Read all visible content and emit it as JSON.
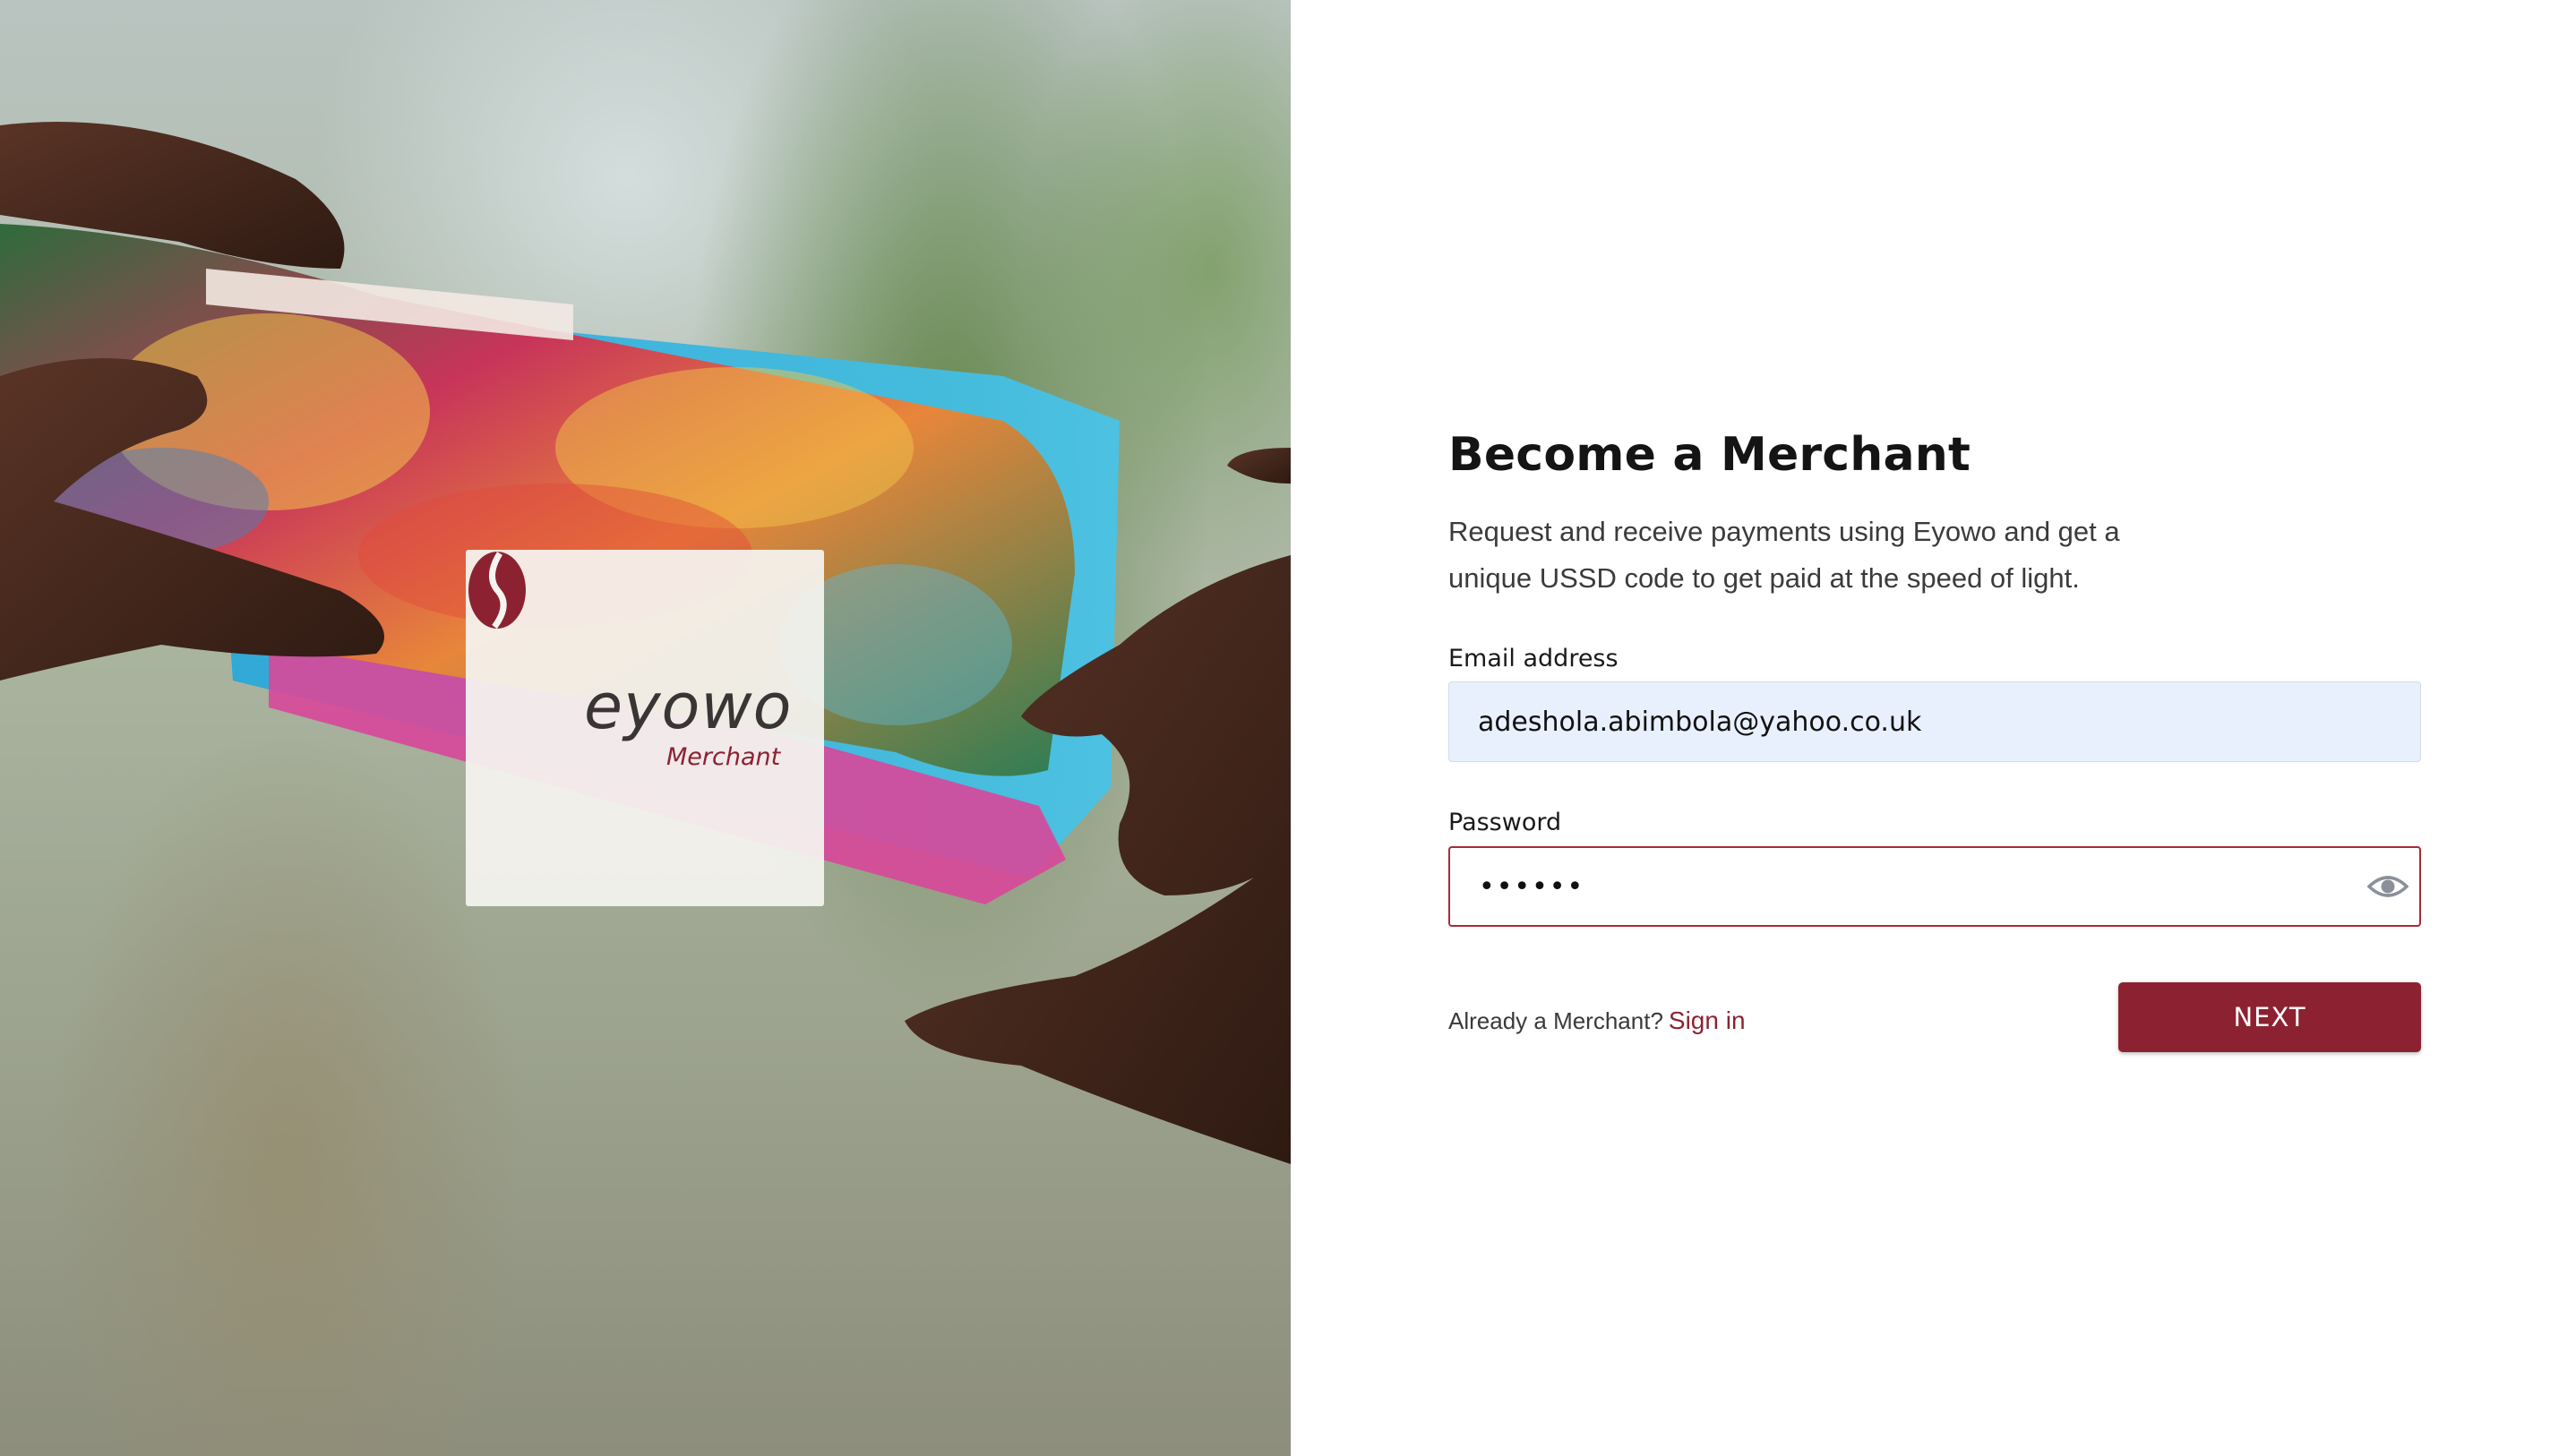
{
  "hero": {
    "logo": {
      "wordmark": "eyowo",
      "subtitle": "Merchant",
      "icon": "eyowo-logo-icon"
    }
  },
  "form": {
    "title": "Become a Merchant",
    "description": "Request and receive payments using Eyowo and get a unique USSD code to get paid at the speed of light.",
    "email": {
      "label": "Email address",
      "value": "adeshola.abimbola@yahoo.co.uk"
    },
    "password": {
      "label": "Password",
      "value": "••••••",
      "toggle_icon": "eye-icon"
    },
    "already_text": "Already a Merchant?",
    "signin_label": "Sign in",
    "next_label": "NEXT"
  },
  "colors": {
    "brand": "#8c2231",
    "email_fill": "#e8f0fe",
    "password_border": "#a72a3a"
  }
}
